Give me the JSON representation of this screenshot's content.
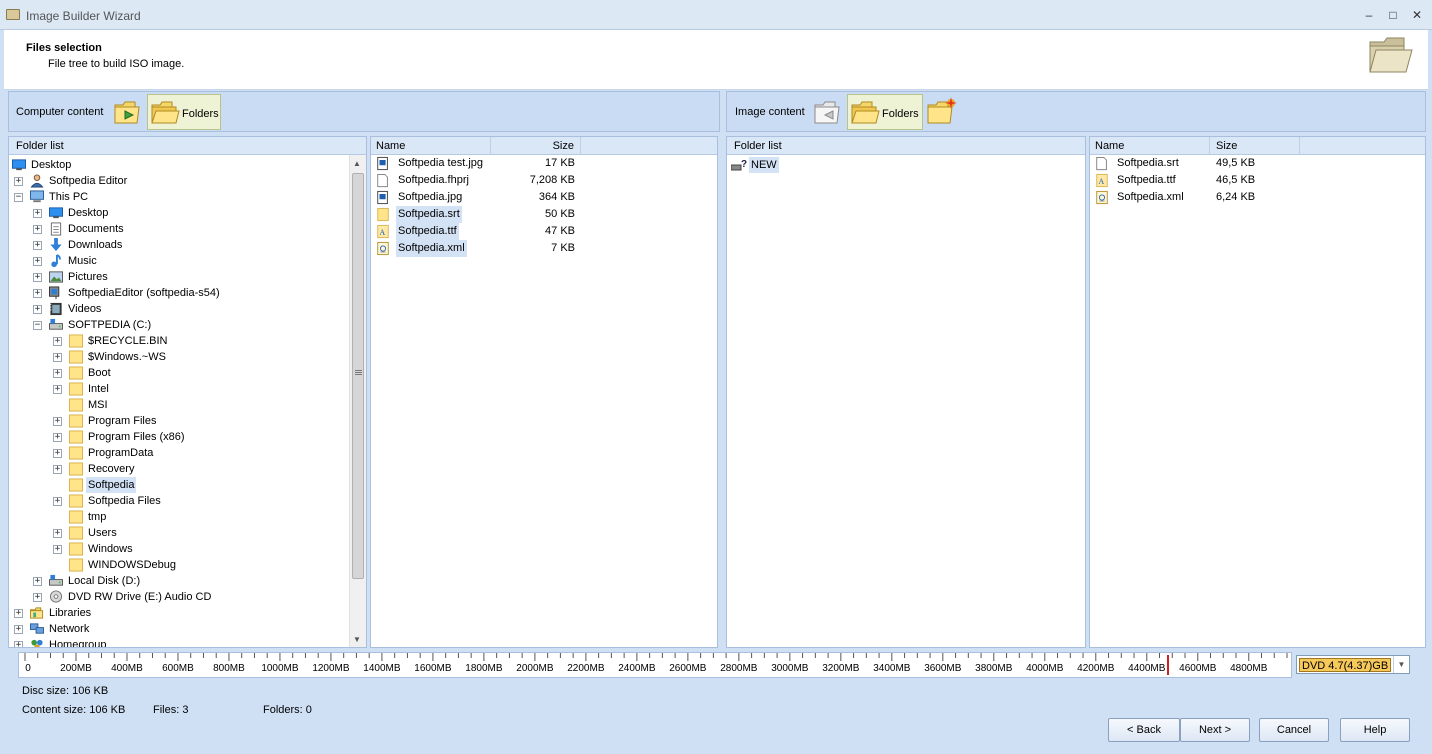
{
  "window": {
    "title": "Image Builder Wizard",
    "minimize": "–",
    "maximize": "□",
    "close": "✕"
  },
  "header": {
    "title": "Files selection",
    "subtitle": "File tree to build ISO image."
  },
  "left_toolbar": {
    "label": "Computer content",
    "folders_label": "Folders"
  },
  "right_toolbar": {
    "label": "Image content",
    "folders_label": "Folders"
  },
  "left_tree": {
    "header": "Folder list",
    "items": [
      {
        "label": "Desktop",
        "icon": "desktop-icon",
        "expander": "",
        "level": 0
      },
      {
        "label": "Softpedia Editor",
        "icon": "user-icon",
        "expander": "+",
        "level": 1
      },
      {
        "label": "This PC",
        "icon": "computer-icon",
        "expander": "−",
        "level": 1
      },
      {
        "label": "Desktop",
        "icon": "desktop-icon",
        "expander": "+",
        "level": 2
      },
      {
        "label": "Documents",
        "icon": "documents-icon",
        "expander": "+",
        "level": 2
      },
      {
        "label": "Downloads",
        "icon": "downloads-icon",
        "expander": "+",
        "level": 2
      },
      {
        "label": "Music",
        "icon": "music-icon",
        "expander": "+",
        "level": 2
      },
      {
        "label": "Pictures",
        "icon": "pictures-icon",
        "expander": "+",
        "level": 2
      },
      {
        "label": "SoftpediaEditor (softpedia-s54)",
        "icon": "network-drive-icon",
        "expander": "+",
        "level": 2
      },
      {
        "label": "Videos",
        "icon": "videos-icon",
        "expander": "+",
        "level": 2
      },
      {
        "label": "SOFTPEDIA (C:)",
        "icon": "drive-icon",
        "expander": "−",
        "level": 2
      },
      {
        "label": "$RECYCLE.BIN",
        "icon": "folder-icon",
        "expander": "+",
        "level": 3
      },
      {
        "label": "$Windows.~WS",
        "icon": "folder-icon",
        "expander": "+",
        "level": 3
      },
      {
        "label": "Boot",
        "icon": "folder-icon",
        "expander": "+",
        "level": 3
      },
      {
        "label": "Intel",
        "icon": "folder-icon",
        "expander": "+",
        "level": 3
      },
      {
        "label": "MSI",
        "icon": "folder-icon",
        "expander": "",
        "level": 3
      },
      {
        "label": "Program Files",
        "icon": "folder-icon",
        "expander": "+",
        "level": 3
      },
      {
        "label": "Program Files (x86)",
        "icon": "folder-icon",
        "expander": "+",
        "level": 3
      },
      {
        "label": "ProgramData",
        "icon": "folder-icon",
        "expander": "+",
        "level": 3
      },
      {
        "label": "Recovery",
        "icon": "folder-icon",
        "expander": "+",
        "level": 3
      },
      {
        "label": "Softpedia",
        "icon": "folder-icon",
        "expander": "",
        "level": 3,
        "selected": true
      },
      {
        "label": "Softpedia Files",
        "icon": "folder-icon",
        "expander": "+",
        "level": 3
      },
      {
        "label": "tmp",
        "icon": "folder-icon",
        "expander": "",
        "level": 3
      },
      {
        "label": "Users",
        "icon": "folder-icon",
        "expander": "+",
        "level": 3
      },
      {
        "label": "Windows",
        "icon": "folder-icon",
        "expander": "+",
        "level": 3
      },
      {
        "label": "WINDOWSDebug",
        "icon": "folder-icon",
        "expander": "",
        "level": 3
      },
      {
        "label": "Local Disk (D:)",
        "icon": "drive-icon",
        "expander": "+",
        "level": 2
      },
      {
        "label": "DVD RW Drive (E:) Audio CD",
        "icon": "dvd-icon",
        "expander": "+",
        "level": 2
      },
      {
        "label": "Libraries",
        "icon": "libraries-icon",
        "expander": "+",
        "level": 1
      },
      {
        "label": "Network",
        "icon": "network-icon",
        "expander": "+",
        "level": 1
      },
      {
        "label": "Homegroup",
        "icon": "homegroup-icon",
        "expander": "+",
        "level": 1
      }
    ]
  },
  "left_files": {
    "columns": {
      "name": "Name",
      "size": "Size"
    },
    "rows": [
      {
        "name": "Softpedia test.jpg",
        "size": "17 KB",
        "icon": "image-file-icon",
        "selected": false
      },
      {
        "name": "Softpedia.fhprj",
        "size": "7,208 KB",
        "icon": "file-icon",
        "selected": false
      },
      {
        "name": "Softpedia.jpg",
        "size": "364 KB",
        "icon": "image-file-icon",
        "selected": false
      },
      {
        "name": "Softpedia.srt",
        "size": "50 KB",
        "icon": "subtitle-file-icon",
        "selected": true
      },
      {
        "name": "Softpedia.ttf",
        "size": "47 KB",
        "icon": "font-file-icon",
        "selected": true
      },
      {
        "name": "Softpedia.xml",
        "size": "7 KB",
        "icon": "xml-file-icon",
        "selected": true
      }
    ]
  },
  "right_tree": {
    "header": "Folder list",
    "items": [
      {
        "label": "NEW",
        "icon": "disc-image-icon",
        "selected": true
      }
    ]
  },
  "right_files": {
    "columns": {
      "name": "Name",
      "size": "Size"
    },
    "rows": [
      {
        "name": "Softpedia.srt",
        "size": "49,5 KB",
        "icon": "file-icon"
      },
      {
        "name": "Softpedia.ttf",
        "size": "46,5 KB",
        "icon": "font-file-icon"
      },
      {
        "name": "Softpedia.xml",
        "size": "6,24 KB",
        "icon": "xml-file-icon"
      }
    ]
  },
  "ruler": {
    "labels": [
      "0",
      "200MB",
      "400MB",
      "600MB",
      "800MB",
      "1000MB",
      "1200MB",
      "1400MB",
      "1600MB",
      "1800MB",
      "2000MB",
      "2200MB",
      "2400MB",
      "2600MB",
      "2800MB",
      "3000MB",
      "3200MB",
      "3400MB",
      "3600MB",
      "3800MB",
      "4000MB",
      "4200MB",
      "4400MB",
      "4600MB",
      "4800MB"
    ],
    "capacity_marker_mb": 4480,
    "max_mb": 4950
  },
  "disc_type": {
    "selected": "DVD 4.7(4.37)GB"
  },
  "status": {
    "disc_size": "Disc size: 106 KB",
    "content_size": "Content size: 106 KB",
    "files": "Files: 3",
    "folders": "Folders: 0"
  },
  "buttons": {
    "back": "< Back",
    "next": "Next >",
    "cancel": "Cancel",
    "help": "Help"
  },
  "colors": {
    "window_bg": "#cfe0f5",
    "selection": "#d3e2f5",
    "active_tab": "#eef3d6",
    "disc_highlight": "#f7c85a",
    "capacity_line": "#d02020"
  }
}
